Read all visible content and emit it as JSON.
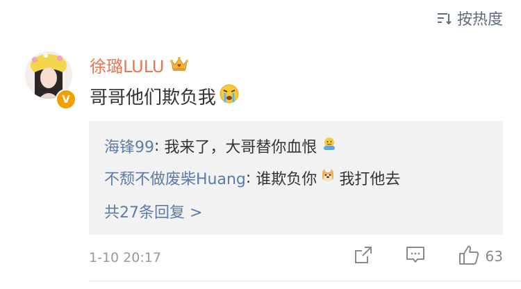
{
  "sort": {
    "label": "按热度",
    "icon": "sort-icon"
  },
  "comment": {
    "username": "徐璐LULU",
    "badge_icon": "crown-icon",
    "verified_mark": "V",
    "content": "哥哥他们欺负我",
    "content_emoji": "crying-emoji-icon",
    "time": "1-10 20:17",
    "like_count": "63"
  },
  "replies": {
    "items": [
      {
        "name": "海锋99",
        "text_before": "我来了，大哥替你血恨",
        "emoji": "hug-emoji-icon",
        "text_after": ""
      },
      {
        "name": "不颓不做废柴Huang",
        "text_before": "谁欺负你",
        "emoji": "doge-emoji-icon",
        "text_after": "我打他去"
      }
    ],
    "more": "共27条回复 >"
  },
  "colors": {
    "username": "#eb7350",
    "link": "#5b7ba8",
    "reply_bg": "#f2f2f2",
    "muted": "#999999"
  }
}
